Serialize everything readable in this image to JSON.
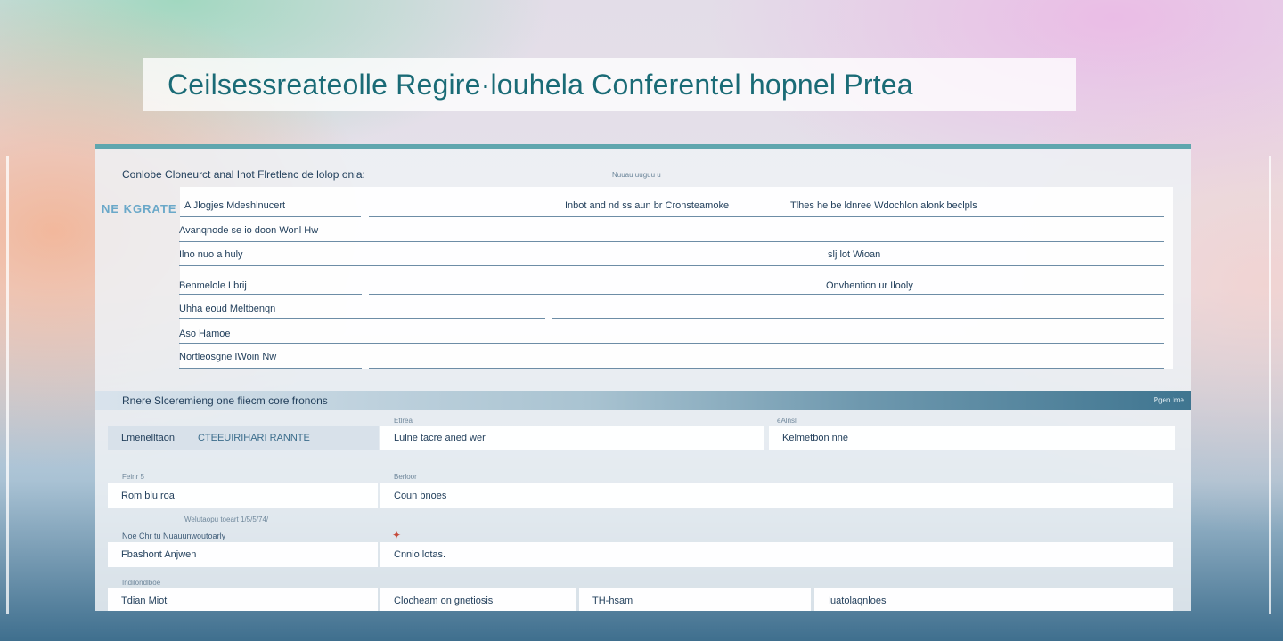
{
  "title": "Ceilsessreateolle Regire·louhela Conferentel hopnel Prtea",
  "panel": {
    "heading": "Conlobe Cloneurct anal Inot Flretlenc de lolop onia:",
    "heading_right": "Nuuau uuguu u",
    "side_tag": "NE KGRATE",
    "rows": [
      {
        "c1": "A Jlogjes Mdeshlnucert",
        "c2": "Inbot and nd ss aun br Cronsteamoke",
        "c3": "Tlhes he be ldnree Wdochlon alonk beclpls"
      },
      {
        "c1": "Avanqnode se io doon Wonl Hw"
      },
      {
        "c1": "Ilno nuo a huly",
        "c3": "slj lot Wioan"
      },
      {
        "c1": "Benmelole Lbrij",
        "c3": "Onvhention ur Ilooly"
      },
      {
        "c1": "Uhha eoud Meltbenqn"
      },
      {
        "c1": "Aso Hamoe"
      },
      {
        "c1": "Nortleosgne IWoin Nw"
      }
    ]
  },
  "section2": {
    "title": "Rnere Slceremieng one fiiecm core fronons",
    "badge": "Pgen Ime",
    "row1": {
      "grey_label": "Lmenelltaon",
      "grey_value": "CTEEUIRIHARI RANNTE",
      "label_mid": "Etlrea",
      "label_right": "eAlnsl",
      "mid": "Lulne tacre aned wer",
      "right": "Kelmetbon nne"
    },
    "row2": {
      "label_left": "Feinr 5",
      "label_mid": "Berloor",
      "left": "Rom blu roa",
      "mid": "Coun bnoes"
    },
    "note1": "Welutaopu toeart 1/5/5/74/",
    "note2": "Noe Chr tu Nuauunwoutoarly",
    "marker": "✦",
    "row3": {
      "left": "Fbashont Anjwen",
      "mid": "Cnnio lotas."
    },
    "row4": {
      "label_left": "Indilondlboe",
      "left": "Tdian Miot",
      "b2": "Clocheam on gnetiosis",
      "b3": "TH-hsam",
      "b4": "Iuatolaqnloes"
    }
  }
}
